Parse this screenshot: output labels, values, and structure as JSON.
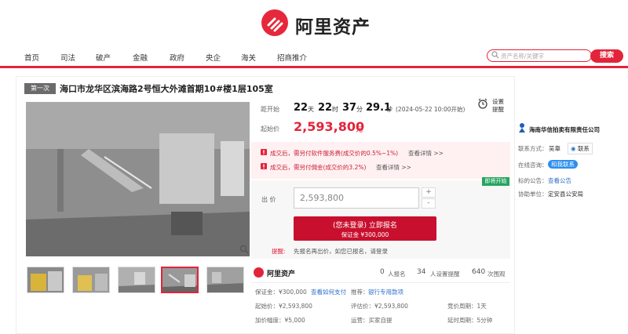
{
  "header": {
    "logo_text": "阿里资产",
    "nav": [
      "首页",
      "司法",
      "破产",
      "金融",
      "政府",
      "央企",
      "海关",
      "招商推介"
    ],
    "search_placeholder": "资产名称/关键字",
    "search_button": "搜索"
  },
  "item": {
    "badge": "第一次",
    "title": "海口市龙华区滨海路2号恒大外滩首期10#楼1层105室"
  },
  "countdown": {
    "label": "距开始",
    "days": "22",
    "days_unit": "天",
    "hours": "22",
    "hours_unit": "时",
    "mins": "37",
    "mins_unit": "分",
    "secs": "29.1",
    "secs_unit": "秒",
    "start": "(2024-05-22 10:00开始)",
    "reminder": "设置提醒"
  },
  "price": {
    "label": "起始价",
    "value": "2,593,800",
    "unit": "元"
  },
  "fees": [
    {
      "text": "成交后，需另付软件服务费(成交价的0.5%~1%)",
      "link": "查看详情 >>"
    },
    {
      "text": "成交后，需另付佣金(成交价的3.2%)",
      "link": "查看详情 >>"
    }
  ],
  "bid": {
    "label": "出 价",
    "value": "2,593,800",
    "plus": "+",
    "minus": "-",
    "button_main": "(您未登录) 立即报名",
    "button_sub": "保证金 ¥300,000",
    "status_tag": "即将开始",
    "tip_label": "提醒:",
    "tip": "先报名再出价，如您已报名，请登录"
  },
  "stats": {
    "brand": "阿里资产",
    "signups_num": "0",
    "signups_label": "人报名",
    "reminders_num": "34",
    "reminders_label": "人设置提醒",
    "views_num": "640",
    "views_label": "次围观"
  },
  "details": {
    "deposit": "保证金：¥300,000",
    "deposit_link": "查看如何支付",
    "recommend_label": "推荐：",
    "recommend_link": "银行专用款项",
    "start_price": "起始价：¥2,593,800",
    "eval_price": "评估价：¥2,593,800",
    "period": "竞价周期：1天",
    "increment": "加价幅度：¥5,000",
    "preempt": "运营：买家自提",
    "delay": "延时周期：5分钟"
  },
  "seller": {
    "name": "海南华信拍卖有限责任公司",
    "contact_label": "联系方式：",
    "contact_name": "吴韋",
    "contact_btn": "联系",
    "online_label": "在线咨询：",
    "online_btn": "和我联系",
    "notice_label": "标的公告：",
    "notice_link": "查看公告",
    "assist_label": "协助单位：",
    "assist_value": "定安县公安局"
  },
  "colors": {
    "accent": "#e2243a",
    "dark_red": "#c8102e",
    "green": "#25a55f",
    "link": "#2b6fc7"
  }
}
